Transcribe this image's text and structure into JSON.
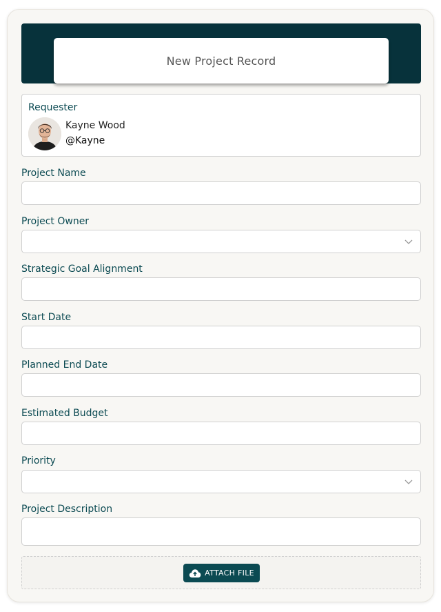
{
  "header": {
    "title": "New Project Record"
  },
  "requester": {
    "label": "Requester",
    "name": "Kayne Wood",
    "handle": "@Kayne"
  },
  "fields": {
    "project_name": {
      "label": "Project Name",
      "value": ""
    },
    "project_owner": {
      "label": "Project Owner",
      "value": ""
    },
    "strategic_goal": {
      "label": "Strategic Goal Alignment",
      "value": ""
    },
    "start_date": {
      "label": "Start Date",
      "value": ""
    },
    "planned_end_date": {
      "label": "Planned End Date",
      "value": ""
    },
    "estimated_budget": {
      "label": "Estimated Budget",
      "value": ""
    },
    "priority": {
      "label": "Priority",
      "value": ""
    },
    "project_description": {
      "label": "Project Description",
      "value": ""
    }
  },
  "attach": {
    "label": "ATTACH FILE",
    "icon": "cloud-upload-icon"
  },
  "colors": {
    "banner": "#07323b",
    "accent": "#0b4a52",
    "card_bg": "#f8f7f4"
  }
}
